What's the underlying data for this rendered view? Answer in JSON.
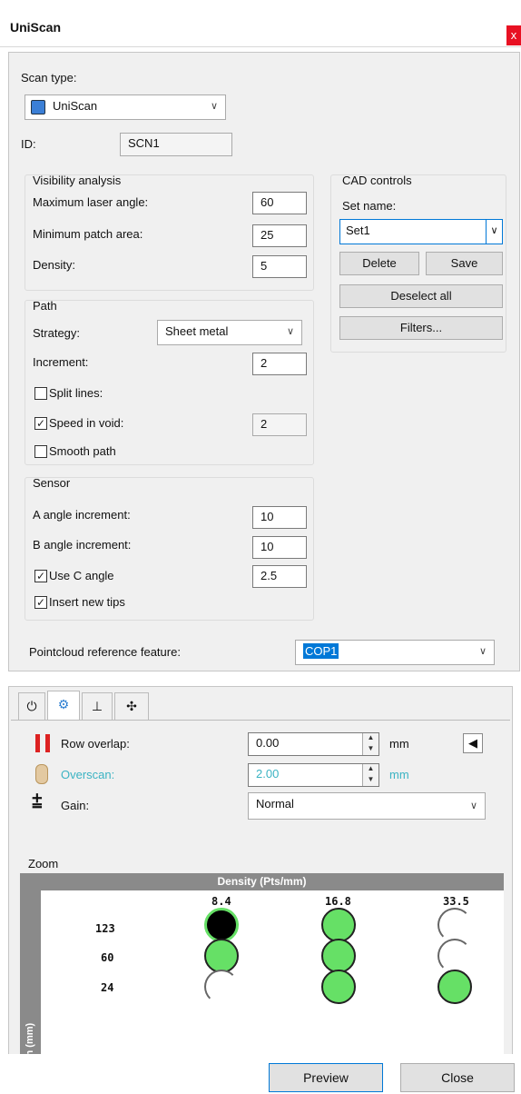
{
  "window": {
    "title": "UniScan",
    "close_glyph": "x"
  },
  "scan_type": {
    "label": "Scan type:",
    "value": "UniScan",
    "icon": "scanner-icon"
  },
  "id": {
    "label": "ID:",
    "value": "SCN1"
  },
  "visibility": {
    "title": "Visibility analysis",
    "max_laser_angle": {
      "label": "Maximum laser angle:",
      "value": "60"
    },
    "min_patch_area": {
      "label": "Minimum patch area:",
      "value": "25"
    },
    "density": {
      "label": "Density:",
      "value": "5"
    }
  },
  "cad": {
    "title": "CAD controls",
    "set_name_label": "Set name:",
    "set_name_value": "Set1",
    "delete_label": "Delete",
    "save_label": "Save",
    "deselect_label": "Deselect all",
    "filters_label": "Filters..."
  },
  "path": {
    "title": "Path",
    "strategy": {
      "label": "Strategy:",
      "value": "Sheet metal"
    },
    "increment": {
      "label": "Increment:",
      "value": "2"
    },
    "split_lines": {
      "label": "Split lines:",
      "checked": false
    },
    "speed_in_void": {
      "label": "Speed in void:",
      "checked": true,
      "value": "2"
    },
    "smooth_path": {
      "label": "Smooth path",
      "checked": false
    }
  },
  "sensor": {
    "title": "Sensor",
    "a_angle": {
      "label": "A angle increment:",
      "value": "10"
    },
    "b_angle": {
      "label": "B angle increment:",
      "value": "10"
    },
    "use_c_angle": {
      "label": "Use C angle",
      "checked": true,
      "value": "2.5"
    },
    "insert_tips": {
      "label": "Insert new tips",
      "checked": true
    }
  },
  "pointcloud": {
    "label": "Pointcloud reference feature:",
    "value": "COP1"
  },
  "tabs": [
    {
      "glyph": "⏻",
      "icon": "power-icon"
    },
    {
      "glyph": "⚙",
      "icon": "laser-settings-icon"
    },
    {
      "glyph": "⊥",
      "icon": "axis-icon"
    },
    {
      "glyph": "✣",
      "icon": "target-icon"
    }
  ],
  "laser": {
    "row_overlap": {
      "label": "Row overlap:",
      "value": "0.00",
      "unit": "mm"
    },
    "overscan": {
      "label": "Overscan:",
      "value": "2.00",
      "unit": "mm"
    },
    "gain": {
      "label": "Gain:",
      "value": "Normal"
    }
  },
  "zoom": {
    "label": "Zoom",
    "density_header": "Density (Pts/mm)",
    "width_label": "Width (mm)",
    "columns": [
      "8.4",
      "16.8",
      "33.5"
    ],
    "rows": [
      {
        "width": "123",
        "states": [
          "selected",
          "on",
          "off"
        ]
      },
      {
        "width": "60",
        "states": [
          "on",
          "on",
          "off"
        ]
      },
      {
        "width": "24",
        "states": [
          "off",
          "on",
          "on"
        ]
      }
    ]
  },
  "footer": {
    "preview_label": "Preview",
    "close_label": "Close"
  },
  "colors": {
    "accent": "#0078d7",
    "overscan_text": "#3bb3c3",
    "green": "#66e066",
    "close": "#e81123"
  }
}
